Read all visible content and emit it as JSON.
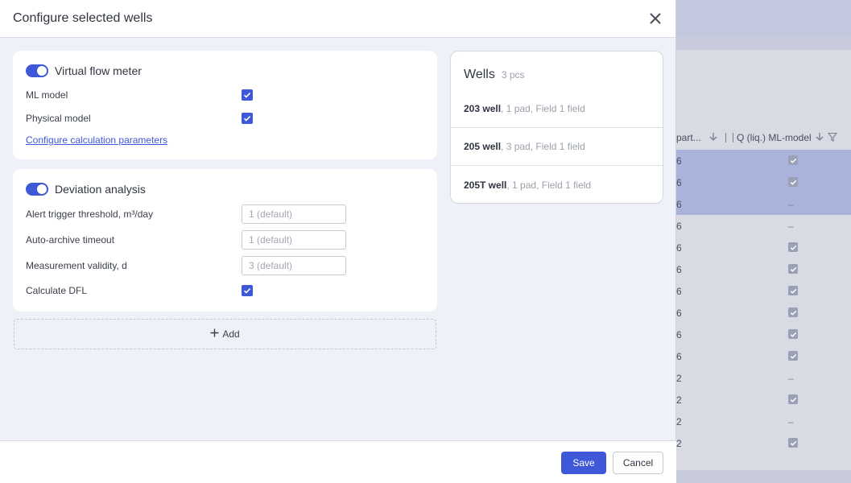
{
  "modal": {
    "title": "Configure selected wells",
    "virtual_flow_meter": {
      "title": "Virtual flow meter",
      "enabled": true,
      "ml_model_label": "ML model",
      "physical_model_label": "Physical model",
      "configure_link": "Configure calculation parameters"
    },
    "deviation_analysis": {
      "title": "Deviation analysis",
      "enabled": true,
      "alert_label": "Alert trigger threshold, m³/day",
      "alert_placeholder": "1 (default)",
      "archive_label": "Auto-archive timeout",
      "archive_placeholder": "1 (default)",
      "validity_label": "Measurement validity, d",
      "validity_placeholder": "3 (default)",
      "dfl_label": "Calculate DFL"
    },
    "add_label": "Add",
    "wells": {
      "title": "Wells",
      "count": "3 pcs",
      "items": [
        {
          "name": "203 well",
          "details": ", 1 pad, Field 1 field"
        },
        {
          "name": "205 well",
          "details": ", 3 pad, Field 1 field"
        },
        {
          "name": "205T well",
          "details": ", 1 pad, Field 1 field"
        }
      ]
    },
    "footer": {
      "save_label": "Save",
      "cancel_label": "Cancel"
    }
  },
  "background_table": {
    "col1_header": "part...",
    "col2_header": "Q (liq.) ML-model",
    "rows": [
      {
        "c1": "6",
        "c2": "check",
        "selected": true
      },
      {
        "c1": "6",
        "c2": "check",
        "selected": true
      },
      {
        "c1": "6",
        "c2": "–",
        "selected": true
      },
      {
        "c1": "6",
        "c2": "–",
        "selected": false
      },
      {
        "c1": "6",
        "c2": "check",
        "selected": false
      },
      {
        "c1": "6",
        "c2": "check",
        "selected": false
      },
      {
        "c1": "6",
        "c2": "check",
        "selected": false
      },
      {
        "c1": "6",
        "c2": "check",
        "selected": false
      },
      {
        "c1": "6",
        "c2": "check",
        "selected": false
      },
      {
        "c1": "6",
        "c2": "check",
        "selected": false
      },
      {
        "c1": "2",
        "c2": "–",
        "selected": false
      },
      {
        "c1": "2",
        "c2": "check",
        "selected": false
      },
      {
        "c1": "2",
        "c2": "–",
        "selected": false
      },
      {
        "c1": "2",
        "c2": "check",
        "selected": false
      }
    ]
  },
  "colors": {
    "accent": "#3f58d8",
    "selected_row": "#aab3dc"
  }
}
